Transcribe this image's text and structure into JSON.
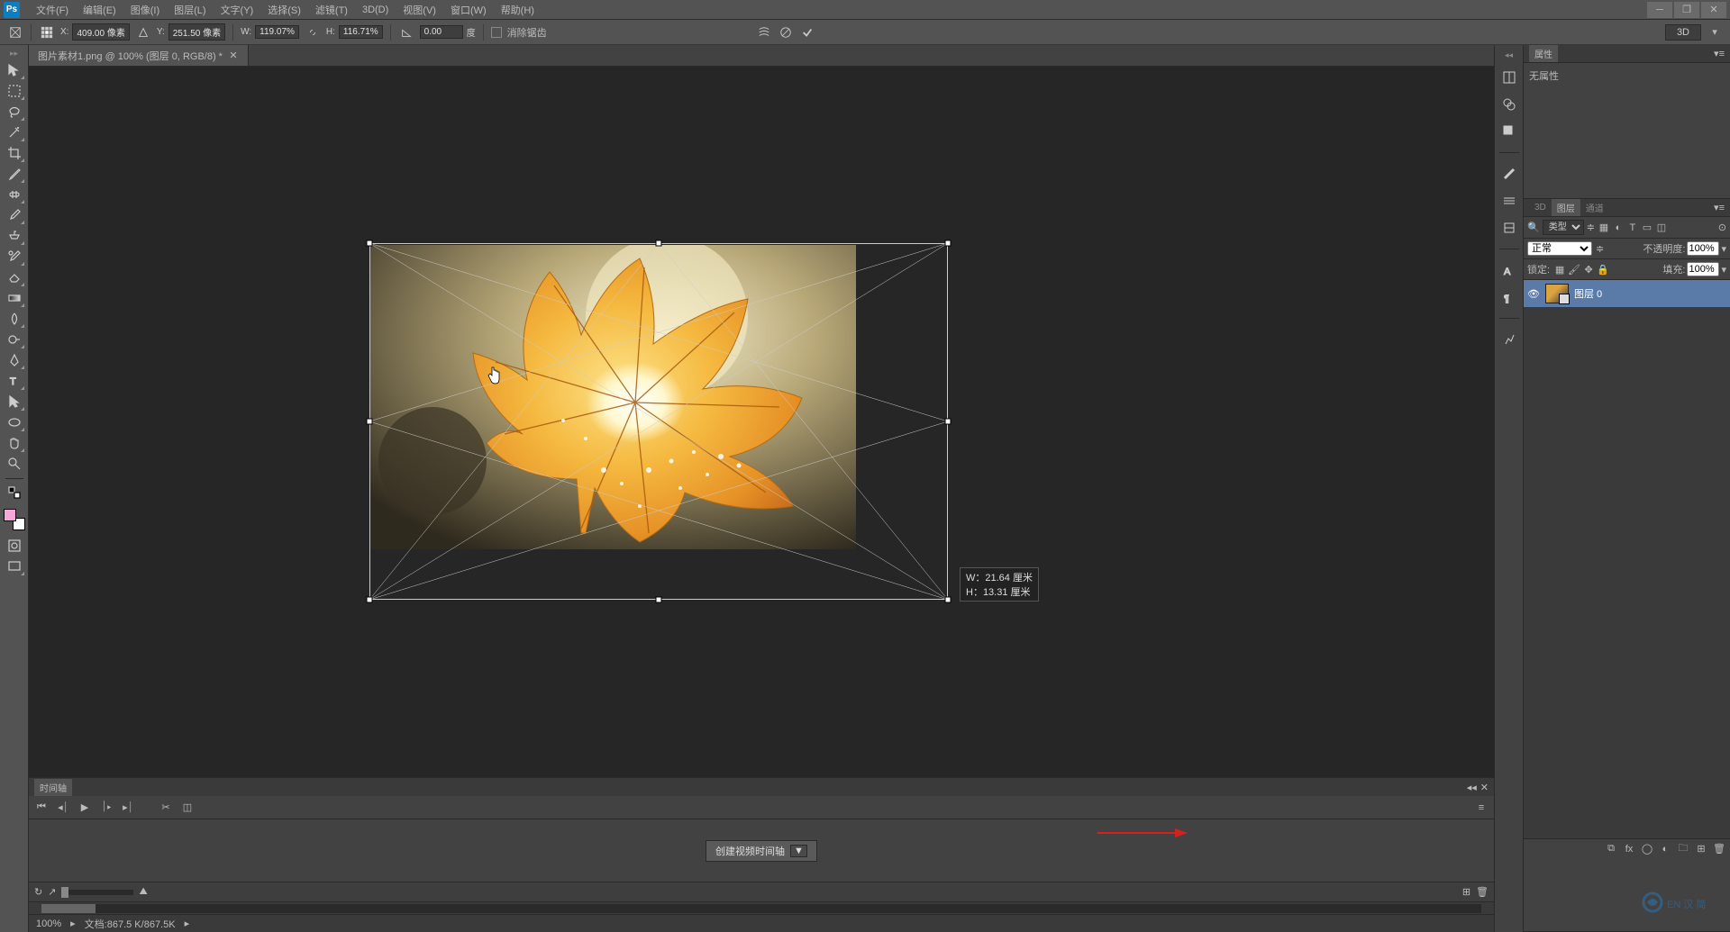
{
  "menu": {
    "logo": "Ps",
    "items": [
      "文件(F)",
      "编辑(E)",
      "图像(I)",
      "图层(L)",
      "文字(Y)",
      "选择(S)",
      "滤镜(T)",
      "3D(D)",
      "视图(V)",
      "窗口(W)",
      "帮助(H)"
    ]
  },
  "options": {
    "x_label": "X:",
    "x_val": "409.00 像素",
    "y_label": "Y:",
    "y_val": "251.50 像素",
    "w_label": "W:",
    "w_val": "119.07%",
    "h_label": "H:",
    "h_val": "116.71%",
    "angle_val": "0.00",
    "angle_unit": "度",
    "antialias": "消除锯齿",
    "btn_3d": "3D"
  },
  "tab": {
    "title": "图片素材1.png @ 100% (图层 0, RGB/8) *"
  },
  "transform_tooltip": {
    "w": "W：21.64 厘米",
    "h": "H：13.31 厘米"
  },
  "properties": {
    "title": "属性",
    "empty": "无属性"
  },
  "layers": {
    "tabs": [
      "3D",
      "图层",
      "通道"
    ],
    "filter_label": "类型",
    "blend_mode": "正常",
    "opacity_label": "不透明度:",
    "opacity_val": "100%",
    "lock_label": "锁定:",
    "fill_label": "填充:",
    "fill_val": "100%",
    "layer_name": "图层 0"
  },
  "timeline": {
    "title": "时间轴",
    "create_btn": "创建视频时间轴"
  },
  "status": {
    "zoom": "100%",
    "doc_info": "文档:867.5 K/867.5K"
  },
  "taskbar_lang": "EN 汉 简"
}
